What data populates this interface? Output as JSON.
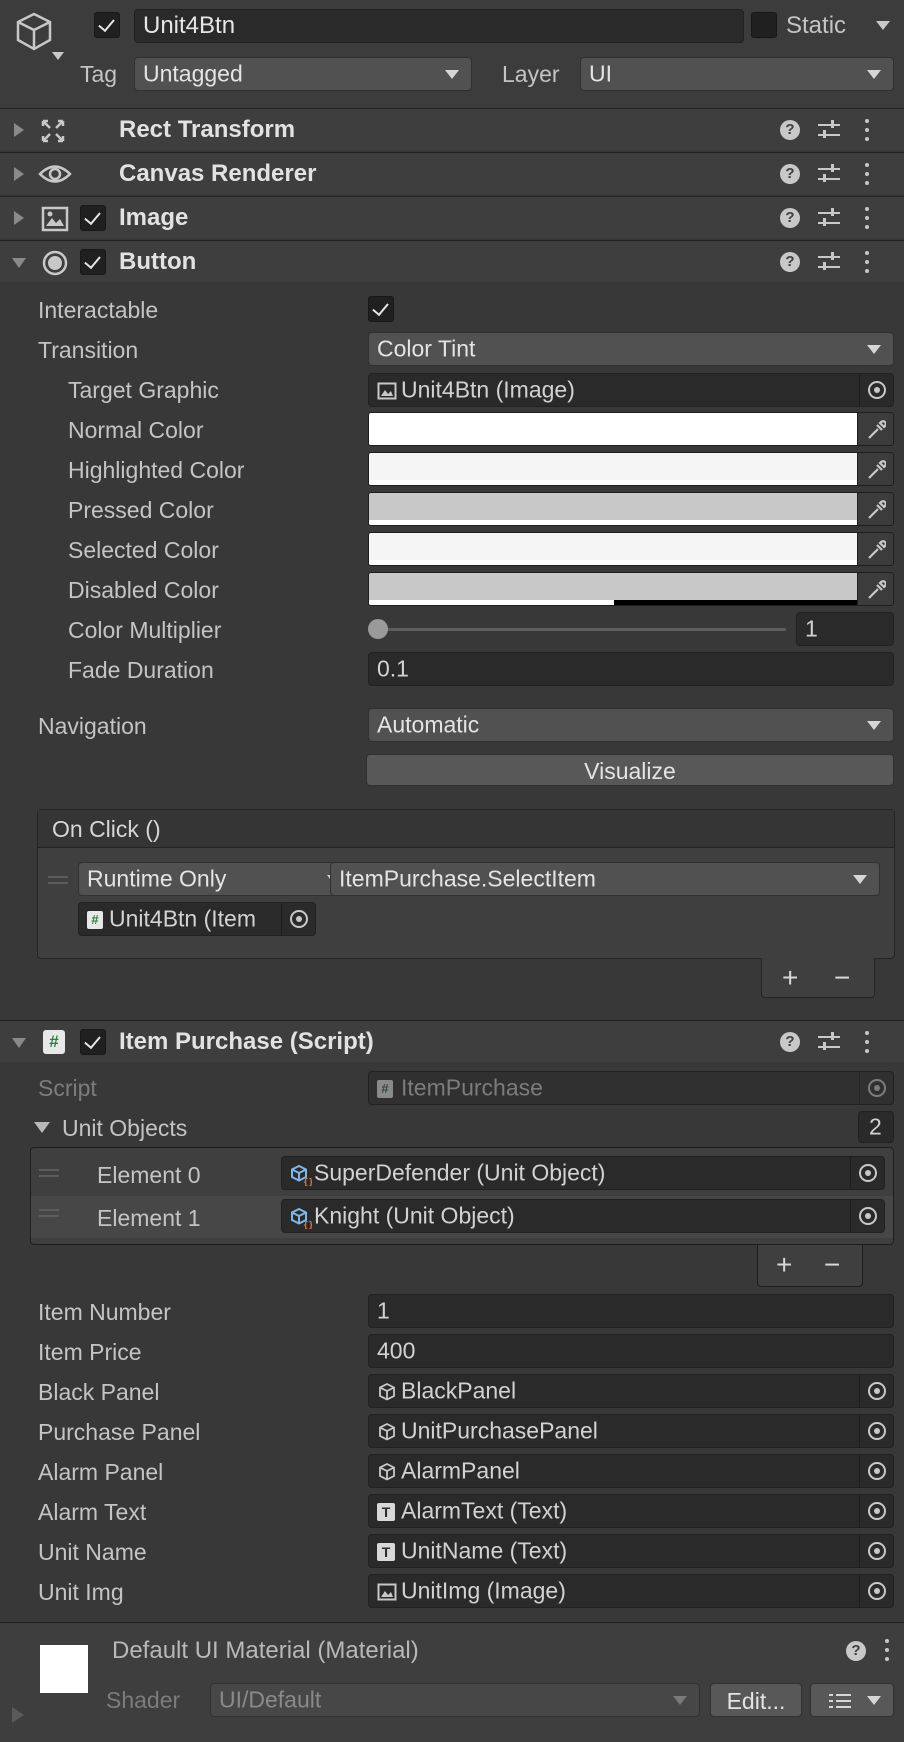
{
  "header": {
    "object_name": "Unit4Btn",
    "static_label": "Static",
    "tag_label": "Tag",
    "tag_value": "Untagged",
    "layer_label": "Layer",
    "layer_value": "UI"
  },
  "components": {
    "rect_transform": "Rect Transform",
    "canvas_renderer": "Canvas Renderer",
    "image": "Image",
    "button": "Button",
    "item_purchase": "Item Purchase (Script)"
  },
  "button": {
    "interactable_label": "Interactable",
    "transition_label": "Transition",
    "transition_value": "Color Tint",
    "target_graphic_label": "Target Graphic",
    "target_graphic_value": "Unit4Btn (Image)",
    "normal_color_label": "Normal Color",
    "highlighted_color_label": "Highlighted Color",
    "pressed_color_label": "Pressed Color",
    "selected_color_label": "Selected Color",
    "disabled_color_label": "Disabled Color",
    "color_multiplier_label": "Color Multiplier",
    "color_multiplier_value": "1",
    "fade_duration_label": "Fade Duration",
    "fade_duration_value": "0.1",
    "navigation_label": "Navigation",
    "navigation_value": "Automatic",
    "visualize_label": "Visualize",
    "on_click_title": "On Click ()",
    "runtime_value": "Runtime Only",
    "function_value": "ItemPurchase.SelectItem",
    "target_object": "Unit4Btn (Item",
    "add_label": "+",
    "remove_label": "−"
  },
  "colors": {
    "normal": "#ffffff",
    "highlighted": "#f5f5f5",
    "pressed": "#c8c8c8",
    "selected": "#f5f5f5",
    "disabled": "#c8c8c8"
  },
  "item_purchase": {
    "script_label": "Script",
    "script_value": "ItemPurchase",
    "unit_objects_label": "Unit Objects",
    "unit_objects_count": "2",
    "elements": [
      {
        "label": "Element 0",
        "value": "SuperDefender (Unit Object)"
      },
      {
        "label": "Element 1",
        "value": "Knight (Unit Object)"
      }
    ],
    "add_label": "+",
    "remove_label": "−",
    "item_number_label": "Item Number",
    "item_number_value": "1",
    "item_price_label": "Item Price",
    "item_price_value": "400",
    "black_panel_label": "Black Panel",
    "black_panel_value": "BlackPanel",
    "purchase_panel_label": "Purchase Panel",
    "purchase_panel_value": "UnitPurchasePanel",
    "alarm_panel_label": "Alarm Panel",
    "alarm_panel_value": "AlarmPanel",
    "alarm_text_label": "Alarm Text",
    "alarm_text_value": "AlarmText (Text)",
    "unit_name_label": "Unit Name",
    "unit_name_value": "UnitName (Text)",
    "unit_img_label": "Unit Img",
    "unit_img_value": "UnitImg (Image)"
  },
  "material": {
    "name": "Default UI Material (Material)",
    "shader_label": "Shader",
    "shader_value": "UI/Default",
    "edit_label": "Edit..."
  }
}
